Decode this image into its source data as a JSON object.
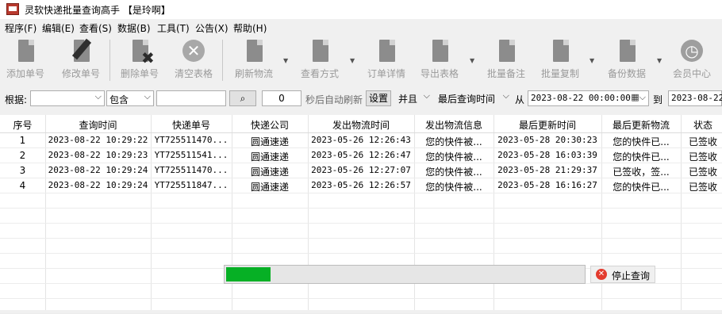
{
  "window": {
    "title": "灵软快递批量查询高手 【是玲啊】"
  },
  "menu": [
    "程序(F)",
    "编辑(E)",
    "查看(S)",
    "数据(B)",
    "工具(T)",
    "公告(X)",
    "帮助(H)"
  ],
  "toolbar": {
    "add": "添加单号",
    "edit": "修改单号",
    "delete": "删除单号",
    "clear": "清空表格",
    "refresh": "刷新物流",
    "view_mode": "查看方式",
    "order_detail": "订单详情",
    "export": "导出表格",
    "batch_note": "批量备注",
    "batch_copy": "批量复制",
    "backup": "备份数据",
    "member": "会员中心"
  },
  "filter": {
    "by_label": "根据:",
    "by_value": "",
    "contains": "包含",
    "search_value": "",
    "search_icon_glyph": "⌕",
    "seconds": "0",
    "auto_refresh_label": "秒后自动刷新",
    "set_button": "设置",
    "and_value": "并且",
    "time_field": "最后查询时间",
    "from_label": "从",
    "from_datetime": "2023-08-22 00:00:00",
    "to_label": "到",
    "to_datetime": "2023-08-22"
  },
  "table": {
    "columns": [
      "序号",
      "查询时间",
      "快递单号",
      "快递公司",
      "发出物流时间",
      "发出物流信息",
      "最后更新时间",
      "最后更新物流",
      "状态"
    ],
    "rows": [
      [
        "1",
        "2023-08-22 10:29:22",
        "YT725511470...",
        "圆通速递",
        "2023-05-26 12:26:43",
        "您的快件被...",
        "2023-05-28 20:30:23",
        "您的快件已...",
        "已签收"
      ],
      [
        "2",
        "2023-08-22 10:29:23",
        "YT725511541...",
        "圆通速递",
        "2023-05-26 12:26:47",
        "您的快件被...",
        "2023-05-28 16:03:39",
        "您的快件已...",
        "已签收"
      ],
      [
        "3",
        "2023-08-22 10:29:24",
        "YT725511470...",
        "圆通速递",
        "2023-05-26 12:27:07",
        "您的快件被...",
        "2023-05-28 21:29:37",
        "已签收，签...",
        "已签收"
      ],
      [
        "4",
        "2023-08-22 10:29:24",
        "YT725511847...",
        "圆通速递",
        "2023-05-26 12:26:57",
        "您的快件被...",
        "2023-05-28 16:16:27",
        "您的快件已...",
        "已签收"
      ]
    ]
  },
  "progress": {
    "fraction": 0.125,
    "color": "#06b025",
    "stop_label": "停止查询"
  }
}
